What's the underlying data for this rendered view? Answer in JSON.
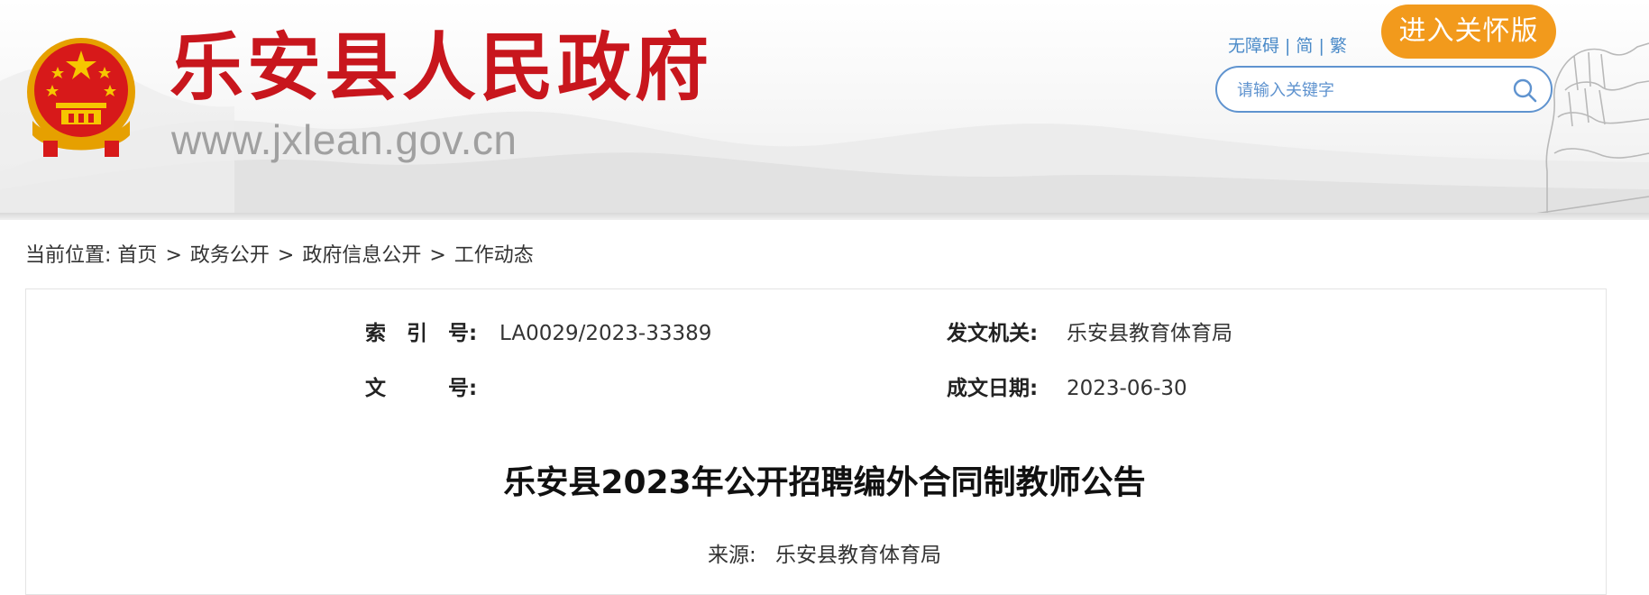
{
  "header": {
    "site_title": "乐安县人民政府",
    "site_url": "www.jxlean.gov.cn",
    "tools": {
      "accessibility": "无障碍",
      "simplified": "简",
      "traditional": "繁",
      "separator": "|"
    },
    "care_mode_label": "进入关怀版",
    "search": {
      "placeholder": "请输入关键字"
    }
  },
  "breadcrumb": {
    "prefix": "当前位置:",
    "items": [
      "首页",
      "政务公开",
      "政府信息公开",
      "工作动态"
    ],
    "separator": ">"
  },
  "meta": {
    "index_label": "索　引　号:",
    "index_value": "LA0029/2023-33389",
    "issuer_label": "发文机关:",
    "issuer_value": "乐安县教育体育局",
    "docno_label": "文　　　号:",
    "docno_value": "",
    "date_label": "成文日期:",
    "date_value": "2023-06-30"
  },
  "article": {
    "title": "乐安县2023年公开招聘编外合同制教师公告",
    "source_label": "来源:",
    "source_value": "乐安县教育体育局"
  },
  "colors": {
    "brand_red": "#c8161d",
    "care_orange": "#f29a1c",
    "link_blue": "#4a8ac8",
    "search_border": "#5f93cf"
  },
  "icons": {
    "emblem": "national-emblem-icon",
    "search": "search-icon",
    "statue": "statue-illustration"
  }
}
